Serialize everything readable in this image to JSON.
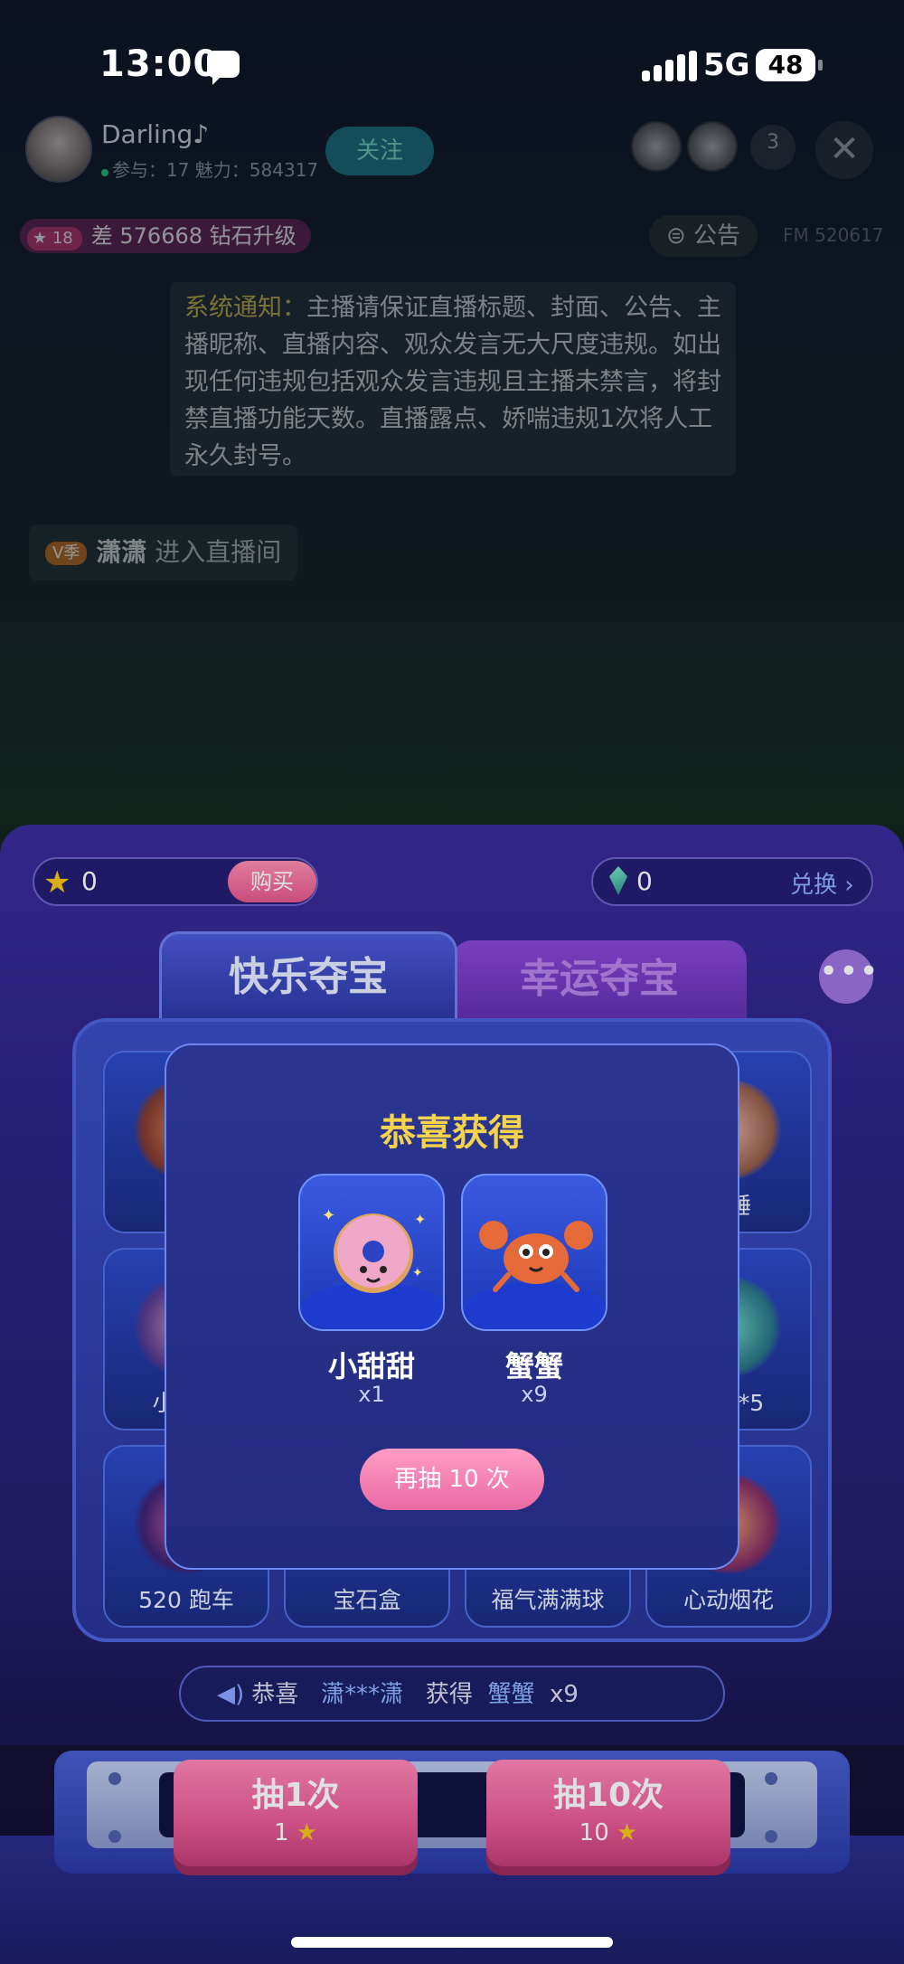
{
  "status": {
    "time": "13:00",
    "network": "5G",
    "battery": "48"
  },
  "host": {
    "name": "Darling♪",
    "stats": "参与：17 魅力：584317",
    "follow_label": "关注",
    "viewer_count": "3",
    "close_symbol": "✕"
  },
  "level": {
    "badge": "18",
    "text": "差 576668 钻石升级"
  },
  "announce_label": "公告",
  "fm": "FM 520617",
  "notice": {
    "label": "系统通知：",
    "text": "主播请保证直播标题、封面、公告、主播昵称、直播内容、观众发言无大尺度违规。如出现任何违规包括观众发言违规且主播未禁言，将封禁直播功能天数。直播露点、娇喘违规1次将人工永久封号。"
  },
  "enter": {
    "vip": "V季",
    "user": "潇潇",
    "action": "进入直播间"
  },
  "panel": {
    "stars": "0",
    "buy_label": "购买",
    "gems": "0",
    "exchange_label": "兑换 ›",
    "tabs": [
      "快乐夺宝",
      "幸运夺宝"
    ],
    "more_symbol": "•••",
    "grid": [
      {
        "label": "蟹蟹"
      },
      {
        "label": "小锤"
      },
      {
        "label": "小甜甜"
      },
      {
        "label": "碎片*5"
      },
      {
        "label": "520 跑车"
      },
      {
        "label": "宝石盒"
      },
      {
        "label": "福气满满球"
      },
      {
        "label": "心动烟花"
      }
    ],
    "ticker": {
      "prefix": "恭喜",
      "user": "潇***潇",
      "mid": "获得",
      "item": "蟹蟹",
      "qty": "x9"
    },
    "draw_buttons": [
      {
        "title": "抽1次",
        "cost": "1"
      },
      {
        "title": "抽10次",
        "cost": "10"
      }
    ]
  },
  "modal": {
    "title": "恭喜获得",
    "prizes": [
      {
        "name": "小甜甜",
        "qty": "x1",
        "icon": "donut-icon"
      },
      {
        "name": "蟹蟹",
        "qty": "x9",
        "icon": "crab-icon"
      }
    ],
    "again_label": "再抽 10 次"
  },
  "colors": {
    "accent_gold": "#f4d34a",
    "pink_button": "#ea6aa4",
    "panel_purple": "#2d2486"
  }
}
